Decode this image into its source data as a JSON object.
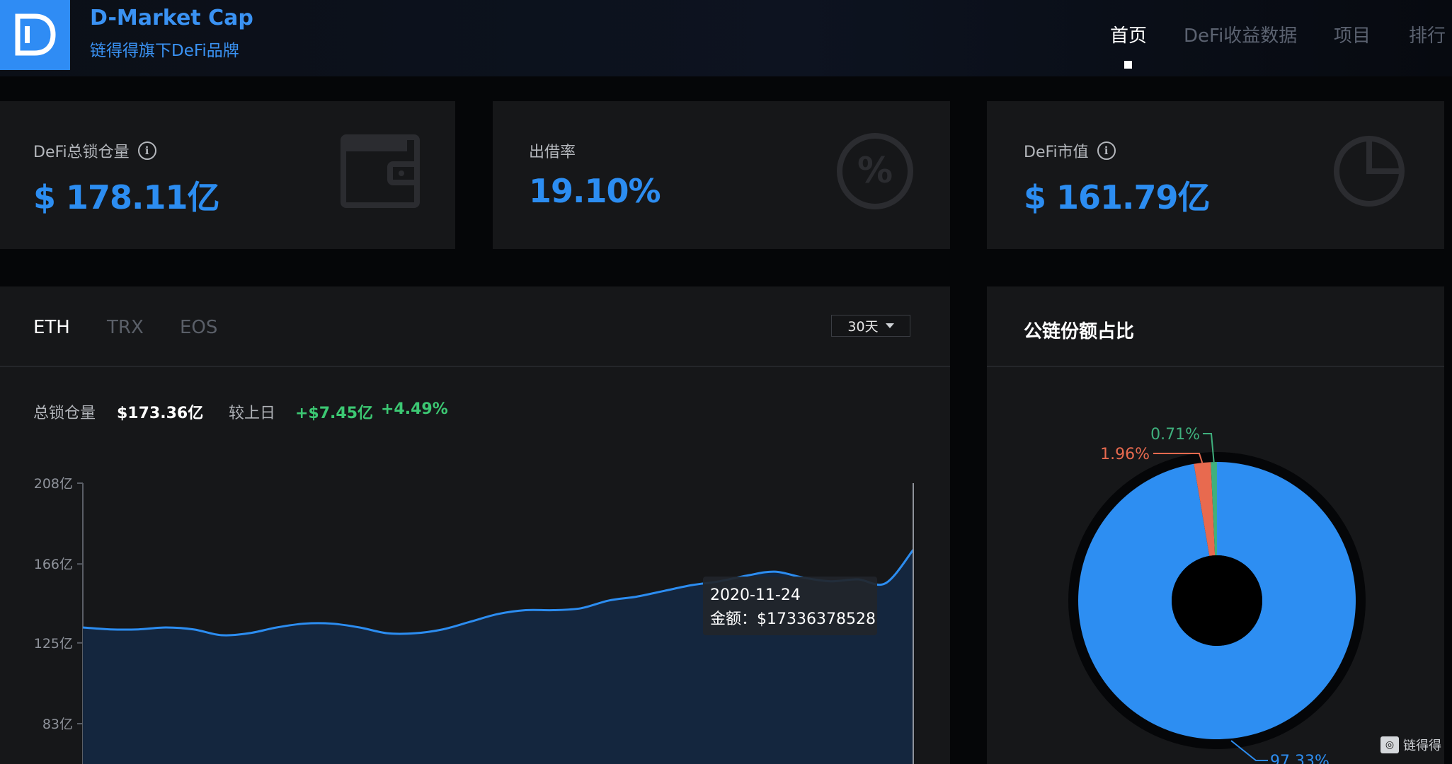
{
  "header": {
    "title": "D-Market Cap",
    "subtitle": "链得得旗下DeFi品牌",
    "nav": [
      "首页",
      "DeFi收益数据",
      "项目",
      "排行"
    ],
    "active_nav": 0
  },
  "stats": {
    "tvl_label": "DeFi总锁仓量",
    "tvl_value": "$ 178.11亿",
    "lend_label": "出借率",
    "lend_value": "19.10%",
    "mcap_label": "DeFi市值",
    "mcap_value": "$ 161.79亿",
    "icons": [
      "wallet-icon",
      "percent-icon",
      "pie-chart-icon",
      "info-icon"
    ]
  },
  "chain_tabs": [
    "ETH",
    "TRX",
    "EOS"
  ],
  "period": "30天",
  "summary": {
    "total_label": "总锁仓量",
    "total_value": "$173.36亿",
    "change_label": "较上日",
    "change_abs": "+$7.45亿",
    "change_pct": "+4.49%"
  },
  "tooltip": {
    "date": "2020-11-24",
    "amount": "金额：$17336378528"
  },
  "pie_title": "公链份额占比",
  "watermark": "链得得",
  "colors": {
    "accent": "#2c8df1",
    "positive": "#3cc873",
    "pie_blue": "#2d8ef2",
    "pie_red": "#e86a4f",
    "pie_green": "#3fb07d"
  },
  "chart_data": [
    {
      "type": "area",
      "title": "",
      "y_tick_labels": [
        "208亿",
        "166亿",
        "125亿",
        "83亿"
      ],
      "y_ticks": [
        208,
        166,
        125,
        83
      ],
      "ylim": [
        83,
        208
      ],
      "grid": false,
      "points": 31,
      "values": [
        133,
        132,
        132,
        133,
        132,
        129,
        130,
        133,
        135,
        135,
        133,
        130,
        130,
        132,
        136,
        140,
        142,
        142,
        143,
        147,
        149,
        152,
        155,
        157,
        160,
        162,
        159,
        157,
        158,
        156,
        173.36
      ]
    },
    {
      "type": "pie",
      "title": "公链份额占比",
      "labels": [
        "97.33%",
        "1.96%",
        "0.71%"
      ],
      "values": [
        97.33,
        1.96,
        0.71
      ]
    }
  ]
}
